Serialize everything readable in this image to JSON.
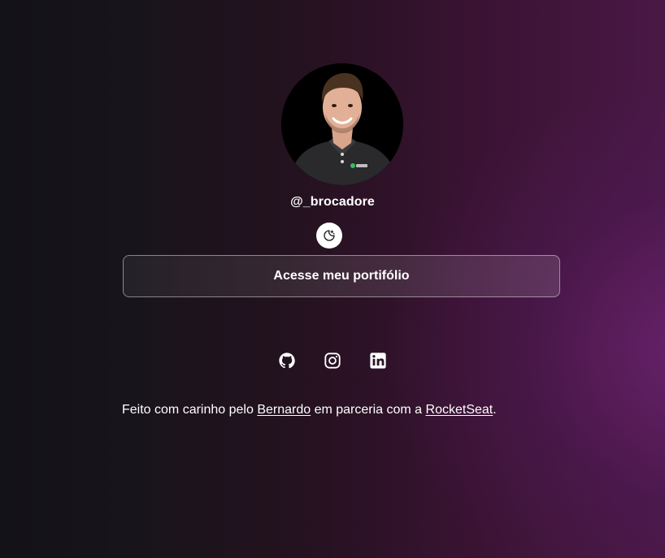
{
  "profile": {
    "handle": "@_brocadore",
    "avatar_alt": "profile-photo"
  },
  "theme_toggle": {
    "icon": "moon-sun-icon"
  },
  "links": [
    {
      "label": "Acesse meu portifólio"
    }
  ],
  "socials": [
    {
      "icon": "github-icon"
    },
    {
      "icon": "instagram-icon"
    },
    {
      "icon": "linkedin-icon"
    }
  ],
  "footer": {
    "prefix": "Feito com carinho pelo ",
    "author": "Bernardo",
    "middle": " em parceria com a ",
    "partner": "RocketSeat",
    "suffix": "."
  },
  "colors": {
    "background_dark": "#131217",
    "background_accent": "#4a1846",
    "text": "#ffffff"
  }
}
